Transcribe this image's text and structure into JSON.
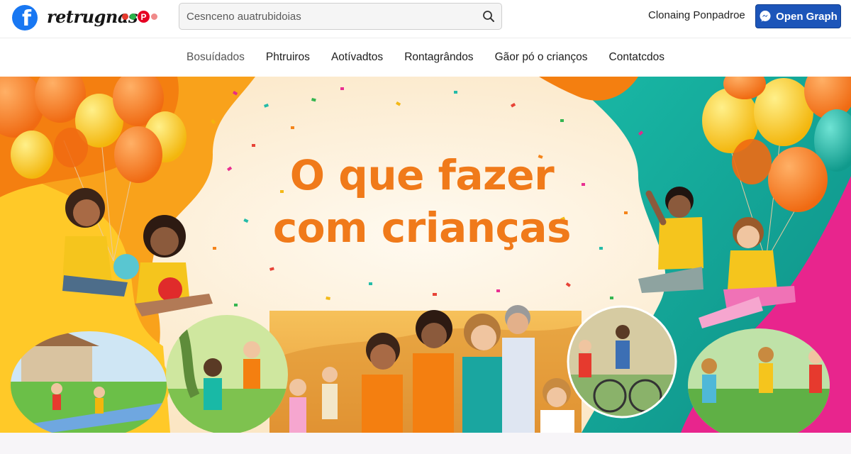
{
  "header": {
    "logo_icon": "facebook-icon",
    "logo_glyph": "f",
    "brand": "retrugnas",
    "brand_dots": [
      "#e63a2e",
      "#2bb34a",
      "#f4b21b"
    ],
    "pinterest_glyph": "P",
    "search_placeholder": "Cesnceno auatrubidoias",
    "link": "Clonaing Ponpadroe",
    "button": "Open Graph",
    "button_icon": "messenger-icon",
    "colors": {
      "facebook": "#1877f2",
      "button": "#1c55b9",
      "pinterest": "#e60023"
    }
  },
  "nav": {
    "items": [
      "Bosuídados",
      "Phtruiros",
      "Aotívadtos",
      "Rontagrândos",
      "Gãor pó o crianços",
      "Contatcdos"
    ]
  },
  "hero": {
    "title_line1": "O que fazer",
    "title_line2": "com crianças",
    "title_color": "#f07a1a"
  }
}
